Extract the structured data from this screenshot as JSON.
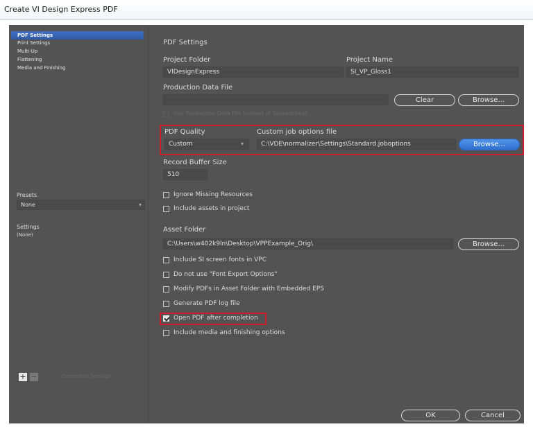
{
  "window": {
    "title": "Create VI Design Express PDF"
  },
  "sidebar": {
    "items": [
      {
        "label": "PDF Settings",
        "selected": true
      },
      {
        "label": "Print Settings"
      },
      {
        "label": "Multi-Up"
      },
      {
        "label": "Flattening"
      },
      {
        "label": "Media and Finishing"
      }
    ],
    "presets_label": "Presets",
    "presets_value": "None",
    "settings_label": "Settings",
    "settings_value": "(None)",
    "add_icon": "+",
    "remove_icon": "−",
    "footer_dim_text": "Create/Edit Settings"
  },
  "main": {
    "section_title": "PDF Settings",
    "project_folder_label": "Project Folder",
    "project_folder_value": "VIDesignExpress",
    "project_name_label": "Project Name",
    "project_name_value": "SI_VP_Gloss1",
    "production_data_label": "Production Data File",
    "production_data_value": "",
    "clear_button": "Clear",
    "browse_button": "Browse...",
    "disabled_checkbox": "Use Production Data File Instead of Spreadsheet",
    "pdf_quality_label": "PDF Quality",
    "pdf_quality_value": "Custom",
    "custom_job_label": "Custom job options file",
    "custom_job_value": "C:\\VDE\\normalizer\\Settings\\Standard.joboptions",
    "record_buffer_label": "Record Buffer Size",
    "record_buffer_value": "510",
    "ignore_missing": "Ignore Missing Resources",
    "include_assets": "Include assets in project",
    "asset_folder_label": "Asset Folder",
    "asset_folder_value": "C:\\Users\\w402k9ln\\Desktop\\VPPExample_Orig\\",
    "include_si_fonts": "Include SI screen fonts in VPC",
    "do_not_use_font": "Do not use \"Font Export Options\"",
    "modify_pdfs": "Modify PDFs in Asset Folder with Embedded EPS",
    "generate_log": "Generate PDF log file",
    "open_pdf": "Open PDF after completion",
    "open_pdf_checked": true,
    "include_media": "Include media and finishing options",
    "ok_button": "OK",
    "cancel_button": "Cancel"
  },
  "colors": {
    "accent_blue": "#2e6fd0",
    "highlight_red": "#d01c2c",
    "panel_bg": "#535353"
  }
}
